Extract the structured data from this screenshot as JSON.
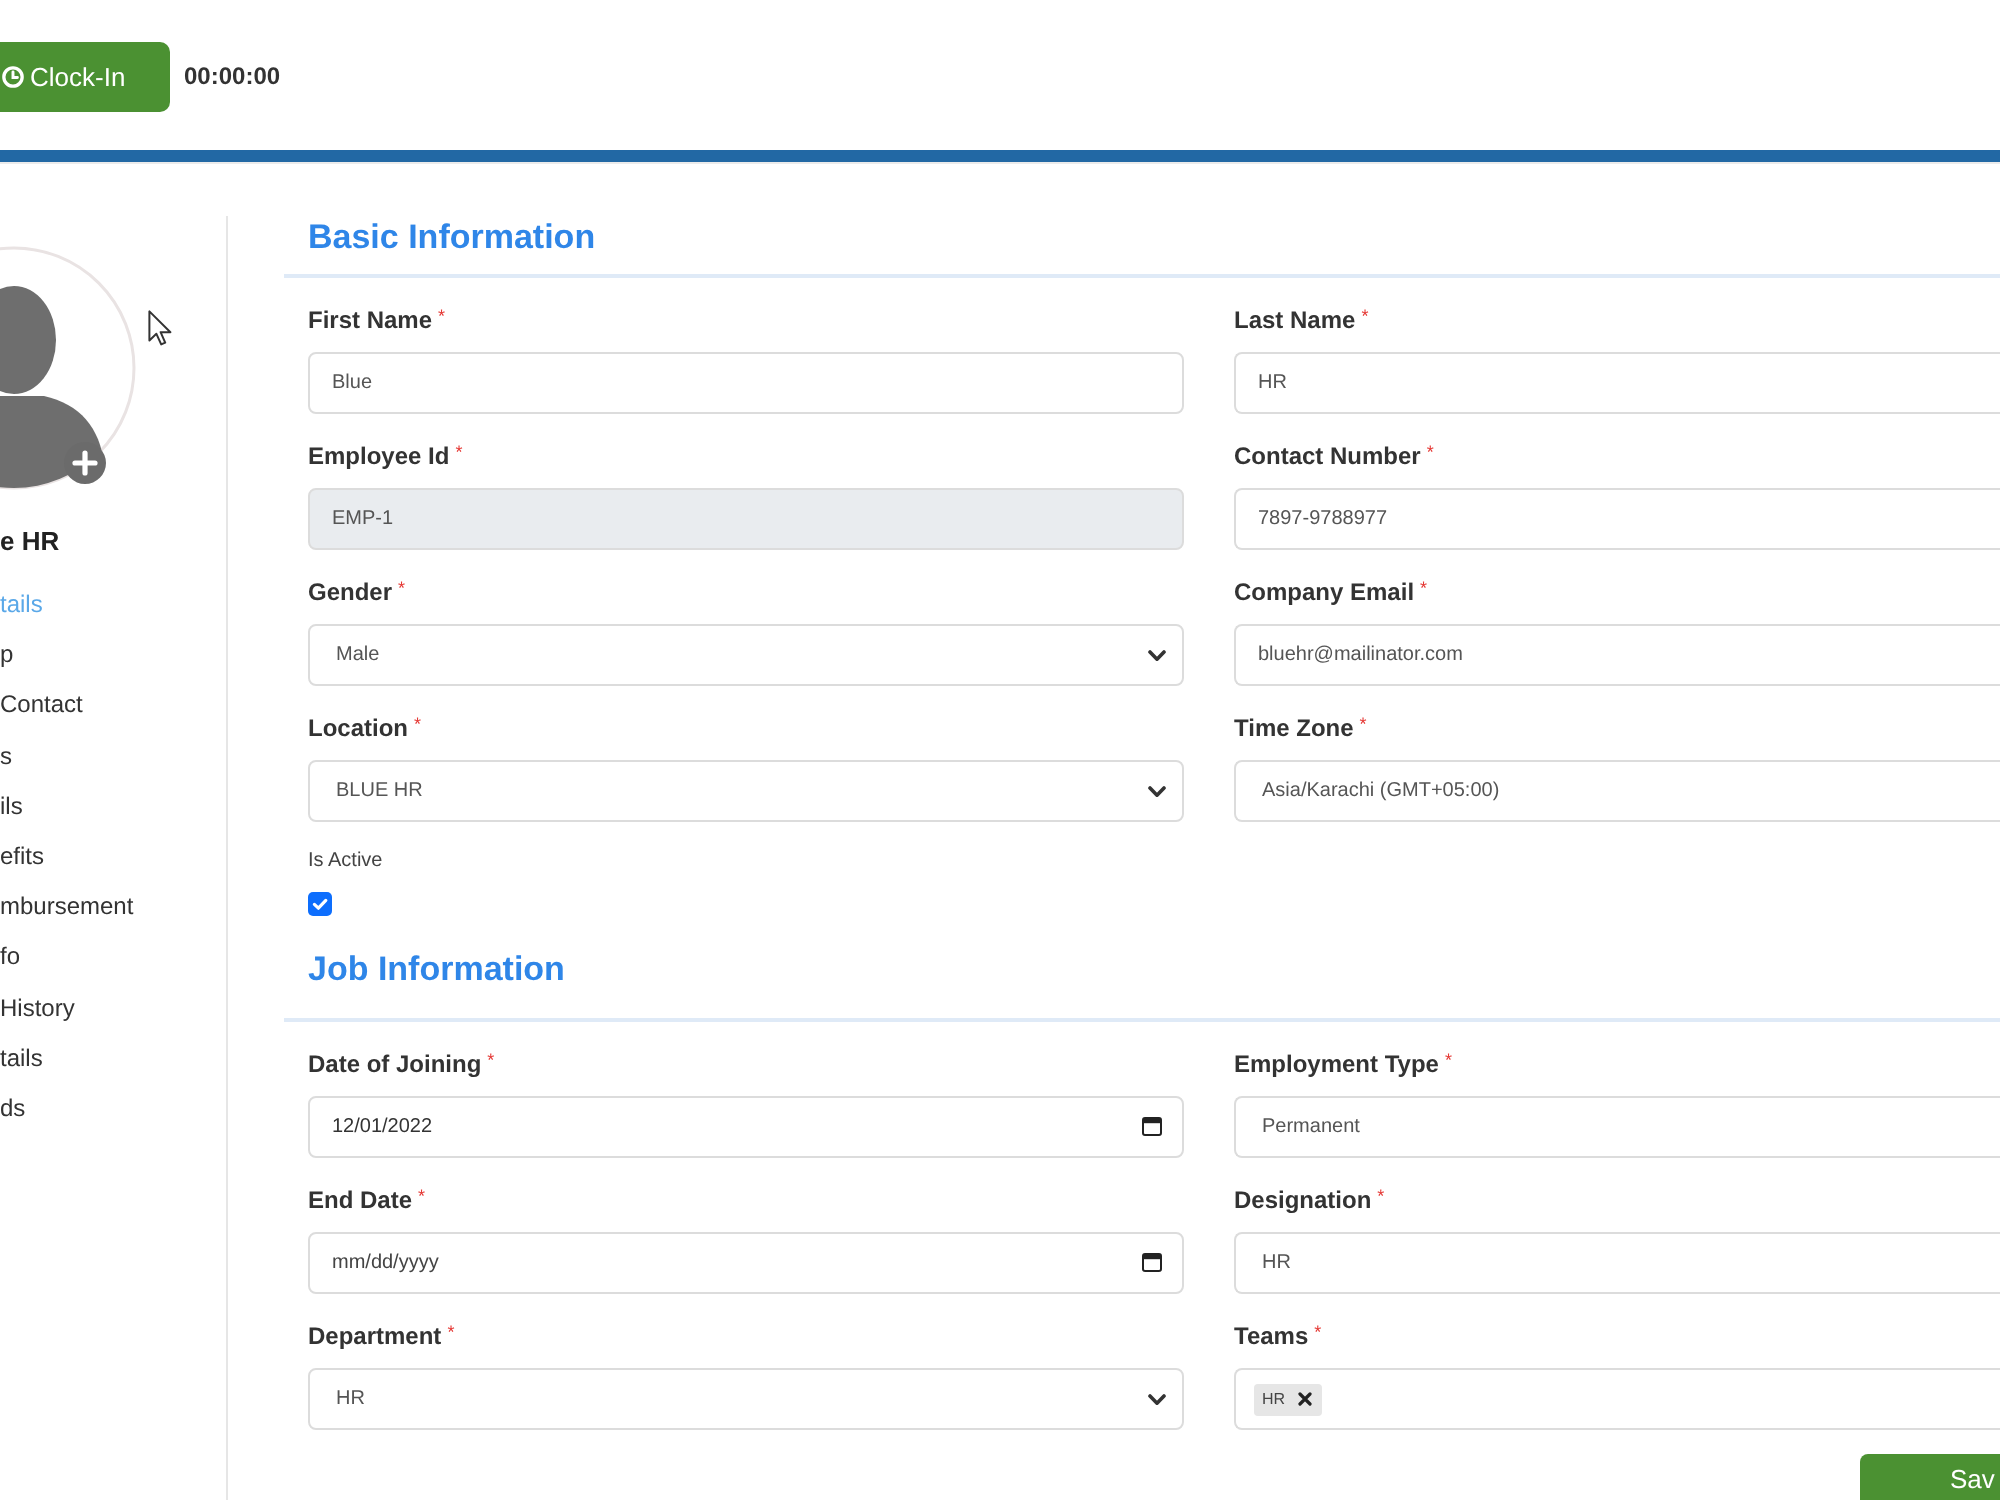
{
  "header": {
    "clock_in_button": {
      "label": "Clock-In"
    },
    "timer": "00:00:00"
  },
  "sidebar": {
    "profile_name": "e HR",
    "items": [
      {
        "label": "tails",
        "selected": true
      },
      {
        "label": "p",
        "selected": false
      },
      {
        "label": "Contact",
        "selected": false
      },
      {
        "label": "s",
        "selected": false
      },
      {
        "label": "ils",
        "selected": false
      },
      {
        "label": "efits",
        "selected": false
      },
      {
        "label": "mbursement",
        "selected": false
      },
      {
        "label": "fo",
        "selected": false
      },
      {
        "label": "History",
        "selected": false
      },
      {
        "label": "tails",
        "selected": false
      },
      {
        "label": "ds",
        "selected": false
      }
    ]
  },
  "sections": [
    {
      "title": "Basic Information",
      "fields": [
        {
          "kind": "text",
          "label": "First Name",
          "required_mark": "*",
          "value": "Blue",
          "disabled": false
        },
        {
          "kind": "text",
          "label": "Last Name",
          "required_mark": "*",
          "value": "HR",
          "disabled": false
        },
        {
          "kind": "text",
          "label": "Employee Id",
          "required_mark": "*",
          "value": "EMP-1",
          "disabled": true
        },
        {
          "kind": "text",
          "label": "Contact Number",
          "required_mark": "*",
          "value": "7897-9788977",
          "disabled": false
        },
        {
          "kind": "select",
          "label": "Gender",
          "required_mark": "*",
          "value": "Male"
        },
        {
          "kind": "text",
          "label": "Company Email",
          "required_mark": "*",
          "value": "bluehr@mailinator.com",
          "disabled": false
        },
        {
          "kind": "select",
          "label": "Location",
          "required_mark": "*",
          "value": "BLUE HR"
        },
        {
          "kind": "select",
          "label": "Time Zone",
          "required_mark": "*",
          "value": "Asia/Karachi (GMT+05:00)"
        },
        {
          "kind": "checkbox",
          "label": "Is Active",
          "checked": true
        }
      ]
    },
    {
      "title": "Job Information",
      "fields": [
        {
          "kind": "date",
          "label": "Date of Joining",
          "required_mark": "*",
          "value": "12/01/2022"
        },
        {
          "kind": "select",
          "label": "Employment Type",
          "required_mark": "*",
          "value": "Permanent"
        },
        {
          "kind": "date",
          "label": "End Date",
          "required_mark": "*",
          "placeholder": "mm/dd/yyyy"
        },
        {
          "kind": "select",
          "label": "Designation",
          "required_mark": "*",
          "value": "HR"
        },
        {
          "kind": "select",
          "label": "Department",
          "required_mark": "*",
          "value": "HR"
        },
        {
          "kind": "tags",
          "label": "Teams",
          "required_mark": "*",
          "tags": [
            "HR"
          ]
        }
      ]
    }
  ],
  "save_button": {
    "label": "Sav"
  }
}
